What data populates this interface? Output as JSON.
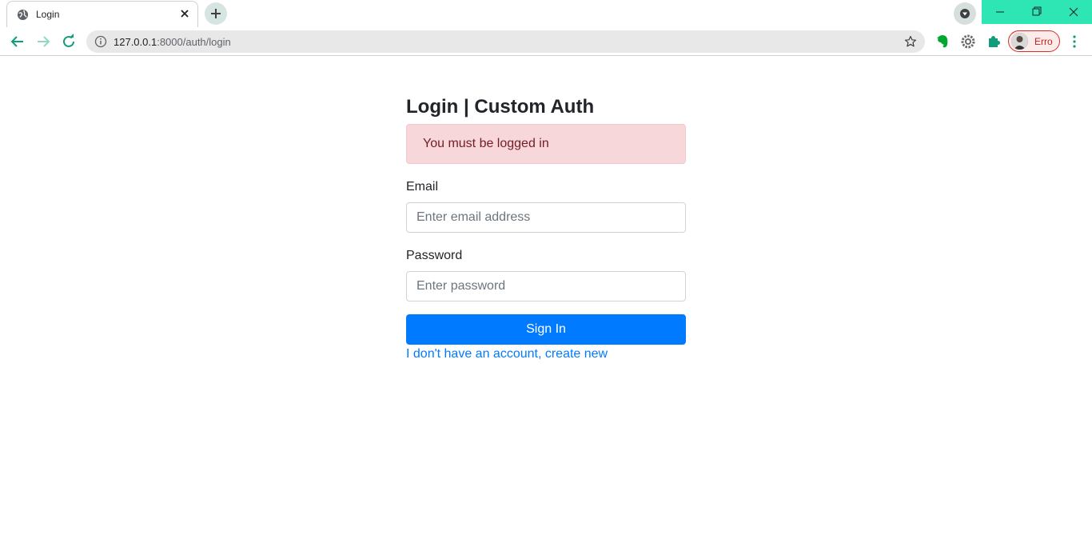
{
  "browser": {
    "tab": {
      "title": "Login"
    },
    "url": {
      "host": "127.0.0.1",
      "path": ":8000/auth/login"
    },
    "profile": {
      "name": "Erro"
    }
  },
  "login": {
    "title": "Login | Custom Auth",
    "alert": "You must be logged in",
    "email_label": "Email",
    "email_placeholder": "Enter email address",
    "password_label": "Password",
    "password_placeholder": "Enter password",
    "submit_label": "Sign In",
    "register_link": "I don't have an account, create new"
  },
  "colors": {
    "primary": "#007bff",
    "alert_bg": "#f8d7da",
    "alert_text": "#721c24",
    "window_controls": "#2ee6b3"
  },
  "icons": [
    "globe-icon",
    "close-icon",
    "plus-icon",
    "chevron-down-icon",
    "minimize-icon",
    "restore-icon",
    "back-arrow-icon",
    "forward-arrow-icon",
    "reload-icon",
    "info-icon",
    "star-icon",
    "evernote-icon",
    "settings-extension-icon",
    "puzzle-icon",
    "kebab-menu-icon"
  ]
}
